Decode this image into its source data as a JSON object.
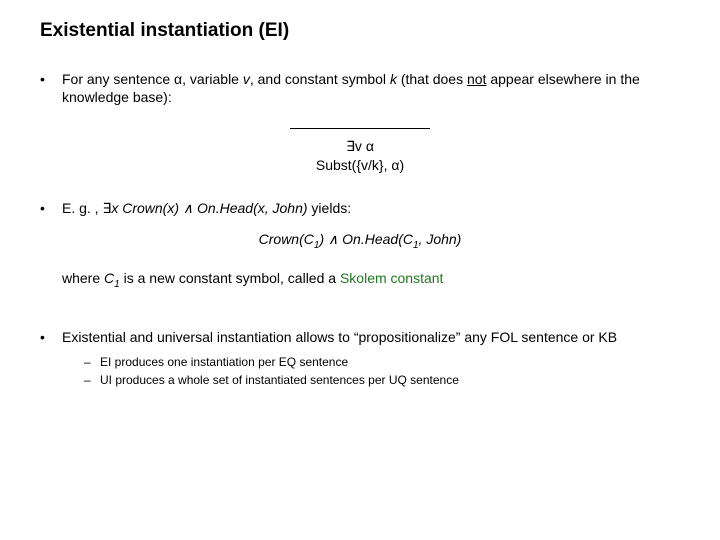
{
  "title": "Existential instantiation (EI)",
  "b1_pre": "For any sentence α, variable ",
  "b1_v": "v",
  "b1_mid1": ", and constant symbol ",
  "b1_k": "k",
  "b1_mid2": " (that does ",
  "b1_not": "not",
  "b1_post": " appear elsewhere in the knowledge base):",
  "rule_top": "∃v α",
  "rule_bottom": "Subst({v/k}, α)",
  "b2_pre": "E. g. , ∃",
  "b2_x": "x",
  "b2_crown": " Crown",
  "b2_paren1": "(x) ∧ ",
  "b2_onhead": "On.Head",
  "b2_paren2": "(x, John)",
  "b2_post": " yields:",
  "formula_crown": "Crown",
  "formula_open1": "(C",
  "formula_sub1": "1",
  "formula_close1": ") ∧ ",
  "formula_onhead": "On.Head",
  "formula_open2": "(C",
  "formula_sub2": "1",
  "formula_close2": ", John)",
  "where_pre": "where ",
  "where_c": "C",
  "where_sub": "1",
  "where_mid": " is a new constant symbol, called a ",
  "where_skolem": "Skolem constant",
  "b3_text": "Existential and universal instantiation allows to “propositionalize” any FOL sentence or KB",
  "sub1": "EI produces one instantiation per EQ sentence",
  "sub2": "UI produces a whole set of instantiated sentences per UQ sentence"
}
